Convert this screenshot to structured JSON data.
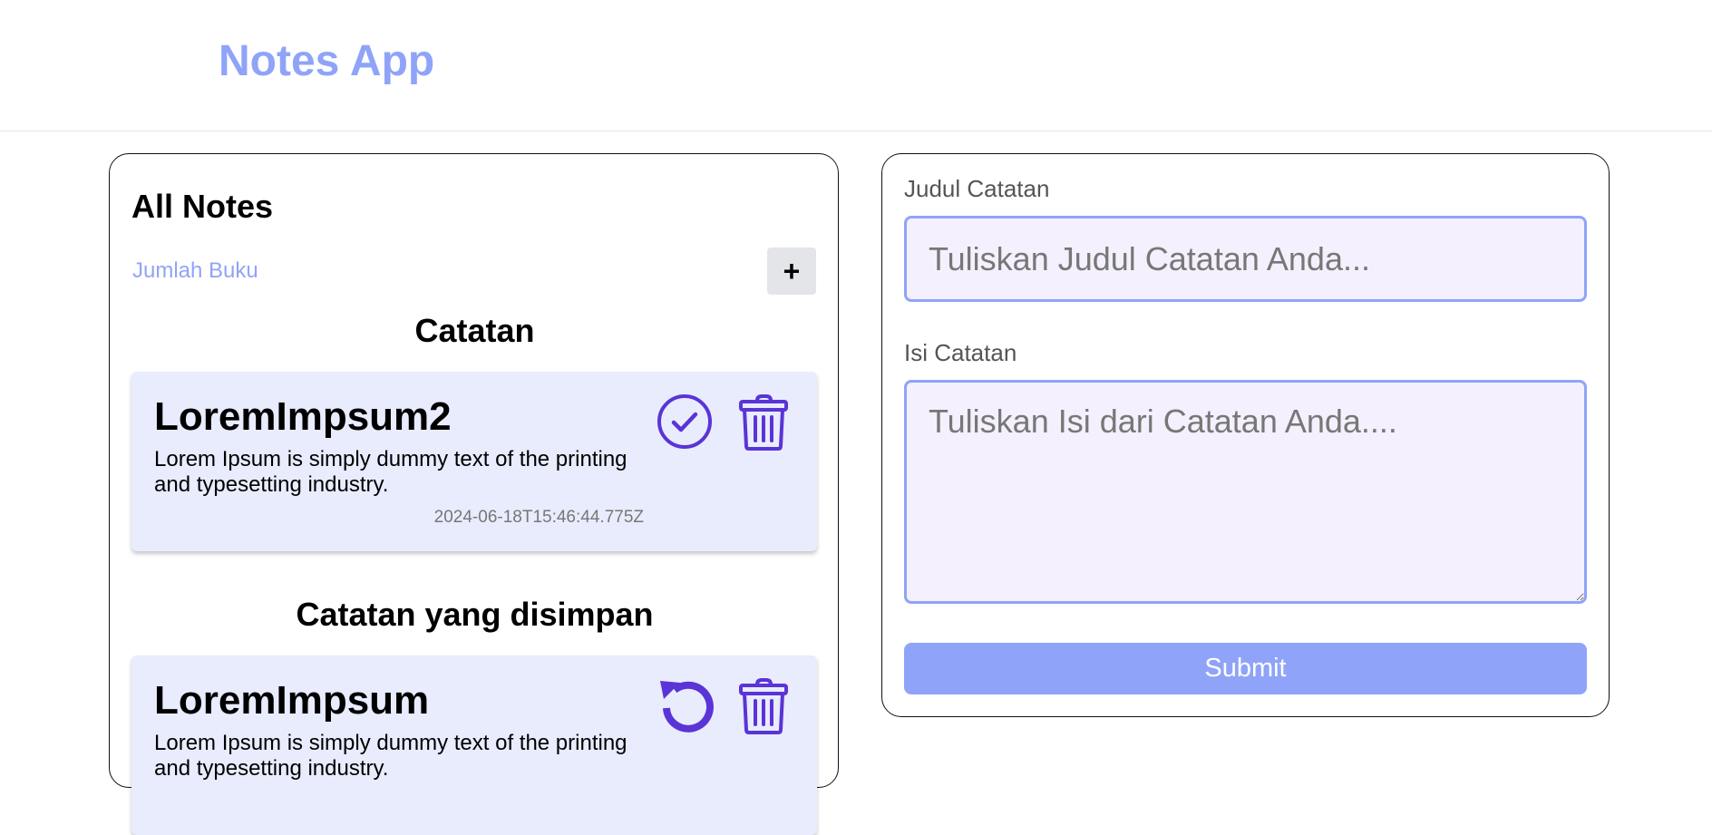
{
  "header": {
    "title": "Notes App"
  },
  "notes_panel": {
    "heading": "All Notes",
    "count_label": "Jumlah Buku",
    "add_label": "+",
    "active_section": {
      "title": "Catatan",
      "notes": [
        {
          "title": "LoremImpsum2",
          "body": "Lorem Ipsum is simply dummy text of the printing and typesetting industry.",
          "date": "2024-06-18T15:46:44.775Z"
        }
      ]
    },
    "archived_section": {
      "title": "Catatan yang disimpan",
      "notes": [
        {
          "title": "LoremImpsum",
          "body": "Lorem Ipsum is simply dummy text of the printing and typesetting industry.",
          "date": ""
        }
      ]
    }
  },
  "form": {
    "title_label": "Judul Catatan",
    "title_placeholder": "Tuliskan Judul Catatan Anda...",
    "title_value": "",
    "body_label": "Isi Catatan",
    "body_placeholder": "Tuliskan Isi dari Catatan Anda....",
    "body_value": "",
    "submit_label": "Submit"
  },
  "icons": {
    "archive": "check-circle-icon",
    "delete": "trash-icon",
    "restore": "rotate-ccw-icon"
  },
  "colors": {
    "accent": "#8fa4f8",
    "icon": "#5a34d6",
    "card_bg": "#e8ecfd",
    "input_bg": "#f4f0fd"
  }
}
